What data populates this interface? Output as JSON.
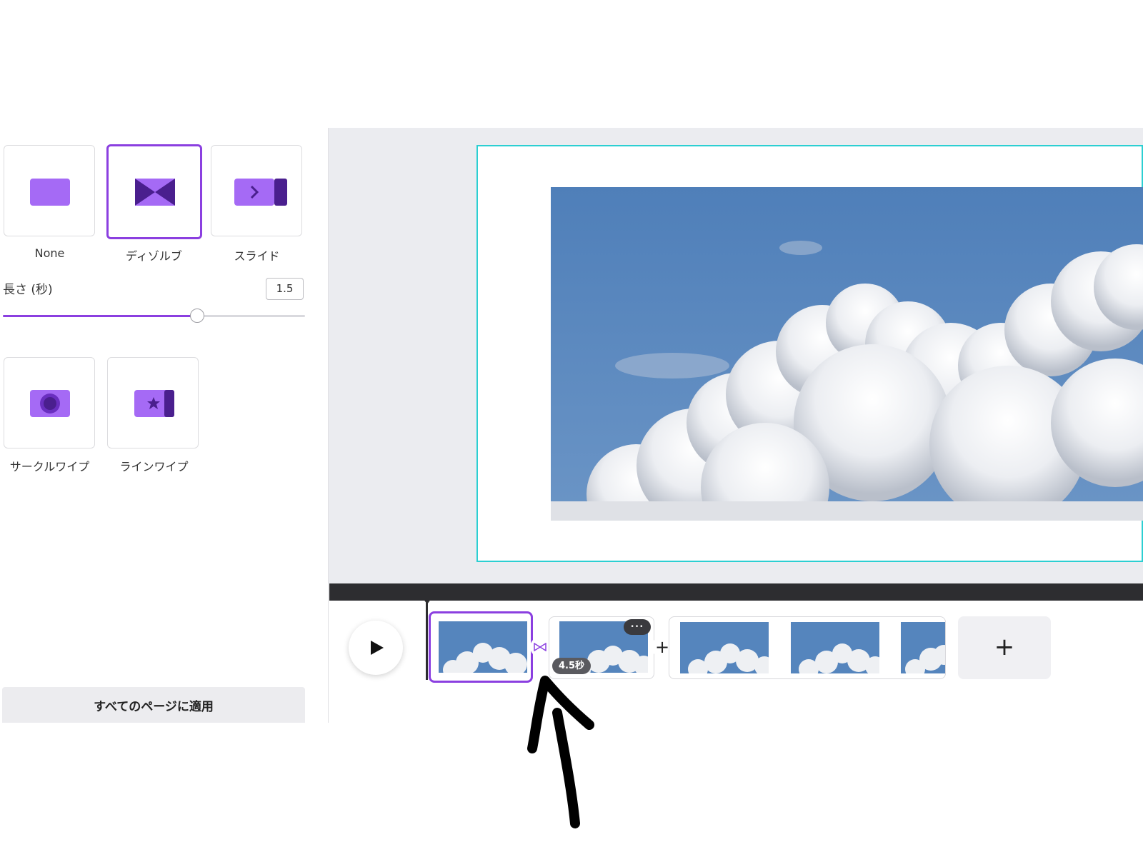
{
  "transitions": {
    "items": [
      {
        "label": "None"
      },
      {
        "label": "ディゾルブ",
        "selected": true
      },
      {
        "label": "スライド"
      },
      {
        "label": "サークルワイプ"
      },
      {
        "label": "ラインワイプ"
      }
    ]
  },
  "duration": {
    "label": "長さ (秒)",
    "value": "1.5",
    "slider_fraction": 0.64
  },
  "apply_all_label": "すべてのページに適用",
  "timeline": {
    "clip_badge": "4.5秒",
    "add_page_symbol": "+",
    "add_between_symbol": "+",
    "more_symbol": "•••"
  },
  "colors": {
    "accent": "#8b3fe0",
    "icon_purple": "#a56af5",
    "icon_dark": "#4a1f8e",
    "canvas_border": "#2ccfd2"
  },
  "icons": [
    "play-icon",
    "plus-icon",
    "more-icon",
    "transition-icon",
    "annotation-arrow"
  ]
}
